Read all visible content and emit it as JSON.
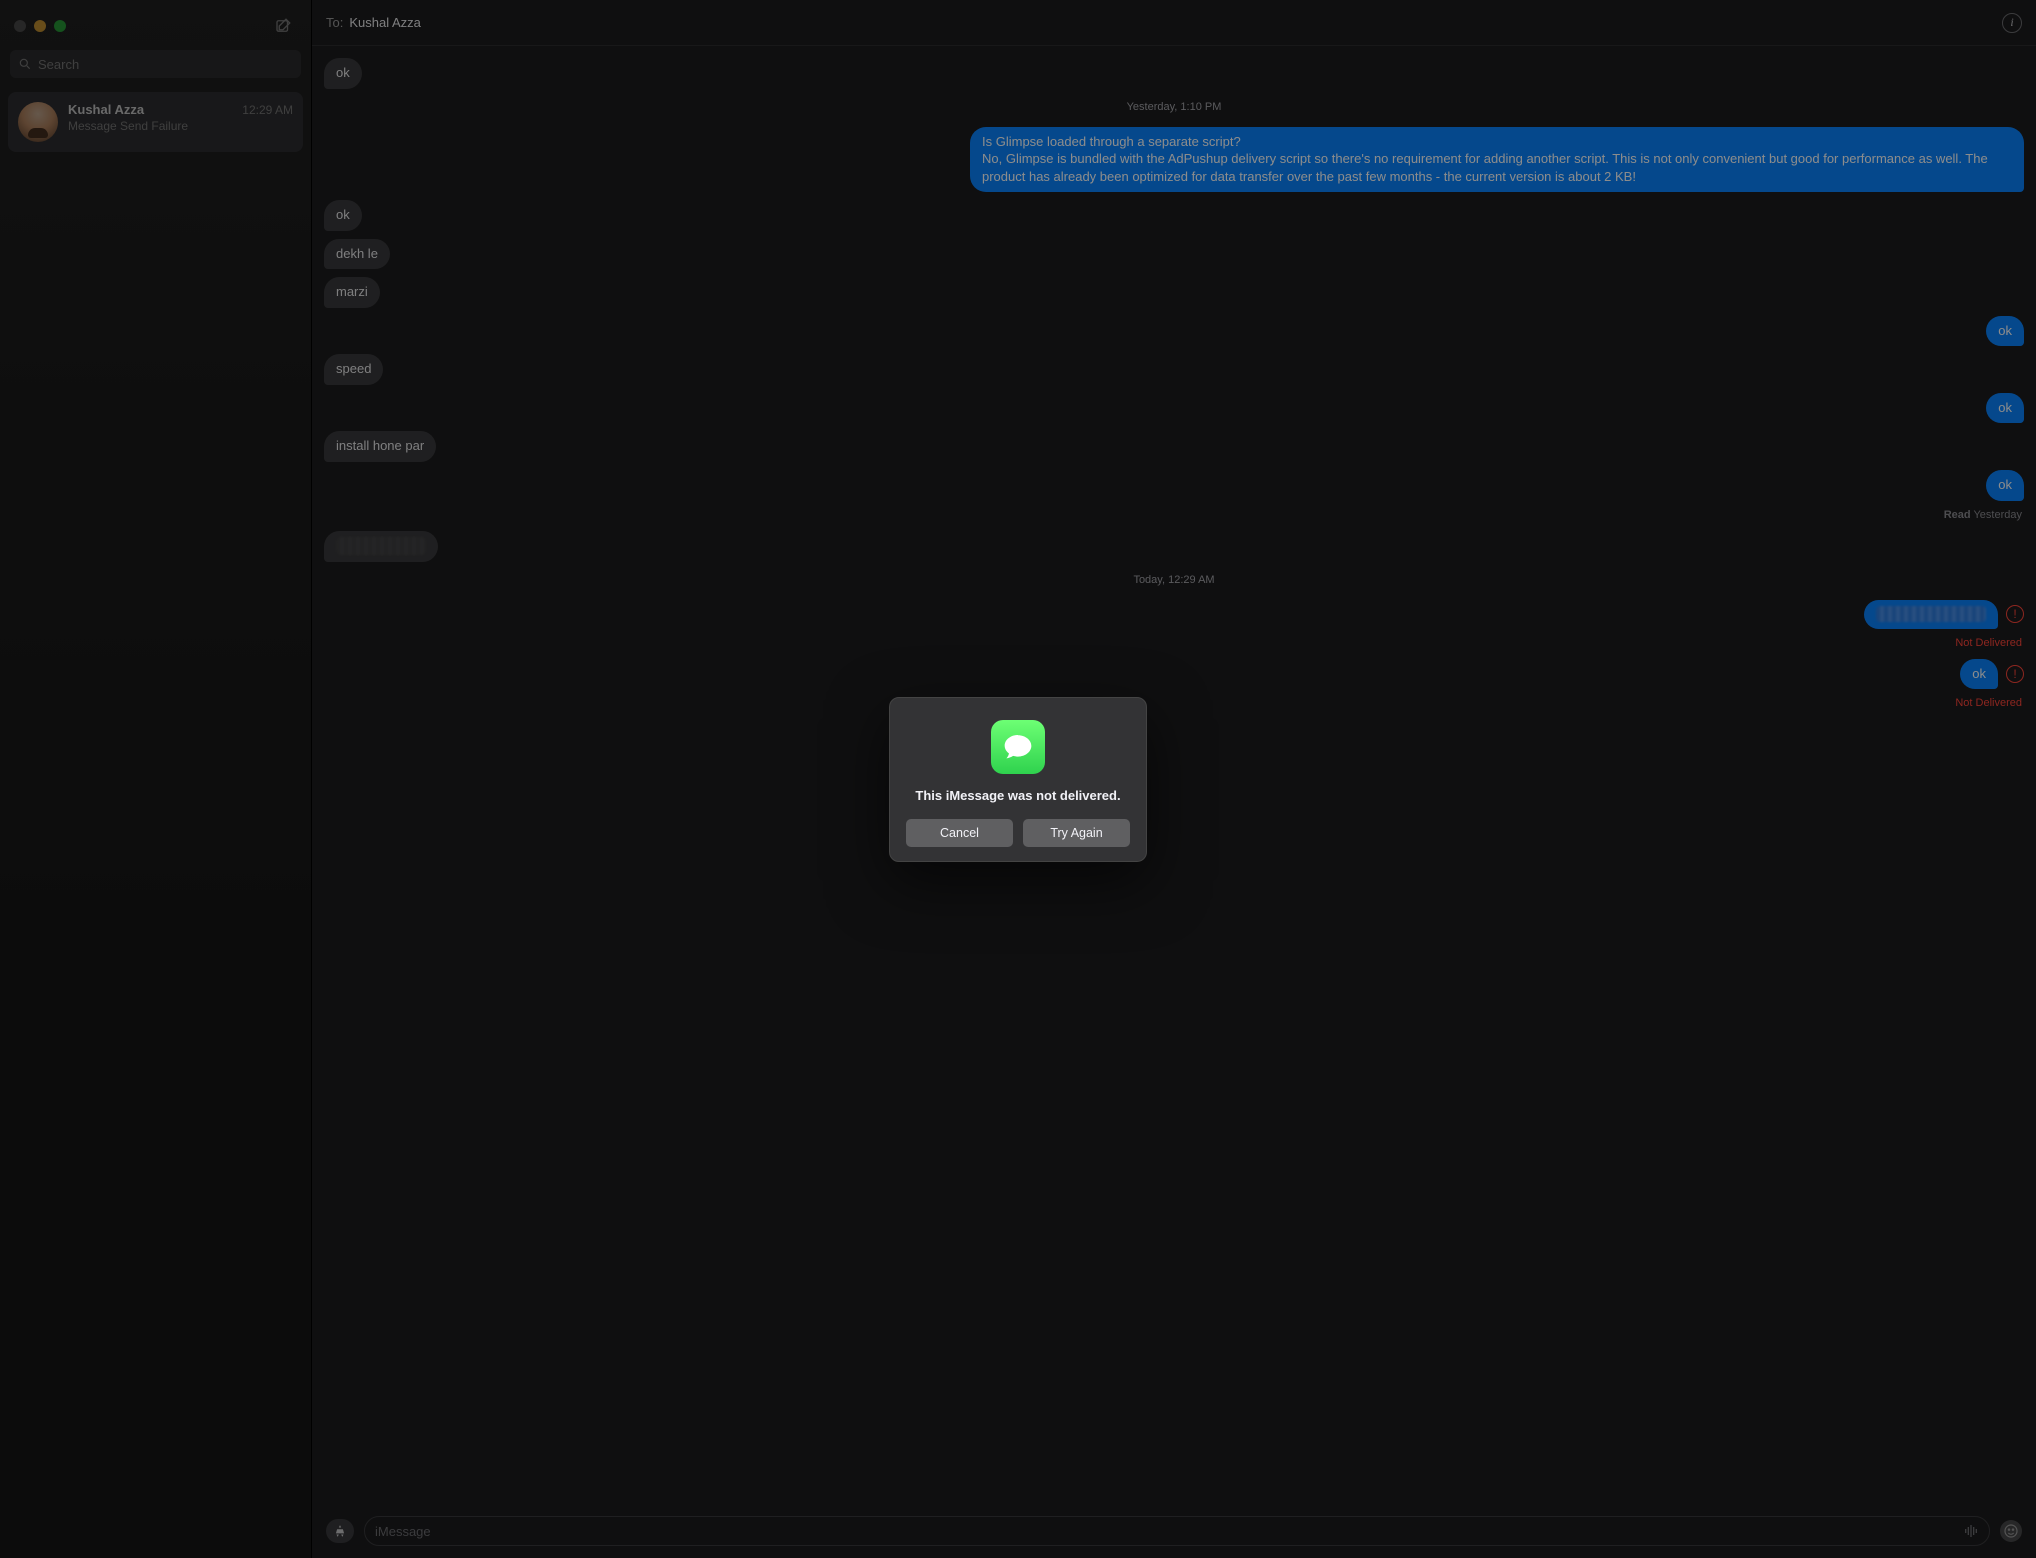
{
  "window": {
    "search_placeholder": "Search"
  },
  "conversations": [
    {
      "name": "Kushal Azza",
      "time": "12:29 AM",
      "preview": "Message Send Failure"
    }
  ],
  "header": {
    "to_label": "To:",
    "to_name": "Kushal Azza"
  },
  "timestamps": {
    "t1": "Yesterday, 1:10 PM",
    "t2": "Today, 12:29 AM"
  },
  "messages": {
    "m0": "ok",
    "m1": "Is Glimpse loaded through a separate script?\nNo, Glimpse is bundled with the AdPushup delivery script so there's no requirement for adding another script. This is not only convenient but good for performance as well. The product has already been optimized for data transfer over the past few months - the current version is about 2 KB!",
    "m2": "ok",
    "m3": "dekh le",
    "m4": "marzi",
    "m5": "ok",
    "m6": "speed",
    "m7": "ok",
    "m8": "install hone par",
    "m9": "ok",
    "m10": "ok"
  },
  "status": {
    "read_prefix": "Read",
    "read_when": "Yesterday",
    "not_delivered": "Not Delivered"
  },
  "compose": {
    "placeholder": "iMessage"
  },
  "modal": {
    "title": "This iMessage was not delivered.",
    "cancel": "Cancel",
    "try_again": "Try Again"
  }
}
